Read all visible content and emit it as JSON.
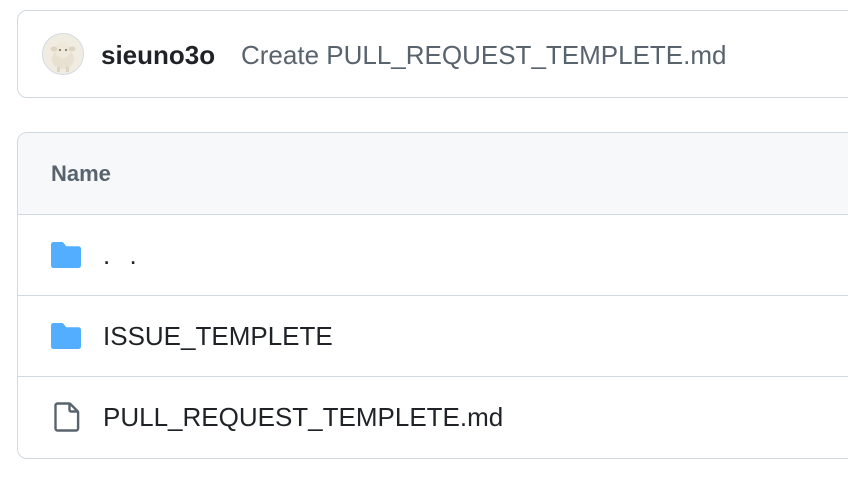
{
  "commit": {
    "author": "sieuno3o",
    "message": "Create PULL_REQUEST_TEMPLETE.md"
  },
  "table": {
    "header_name": "Name",
    "rows": [
      {
        "icon": "folder-icon",
        "label": ". ."
      },
      {
        "icon": "folder-icon",
        "label": "ISSUE_TEMPLETE"
      },
      {
        "icon": "file-icon",
        "label": "PULL_REQUEST_TEMPLETE.md"
      }
    ]
  },
  "colors": {
    "folder": "#54aeff",
    "file_icon": "#59636e",
    "border": "#d1d9e0",
    "header_bg": "#f6f8fa",
    "muted_text": "#59636e",
    "text": "#1f2328"
  }
}
